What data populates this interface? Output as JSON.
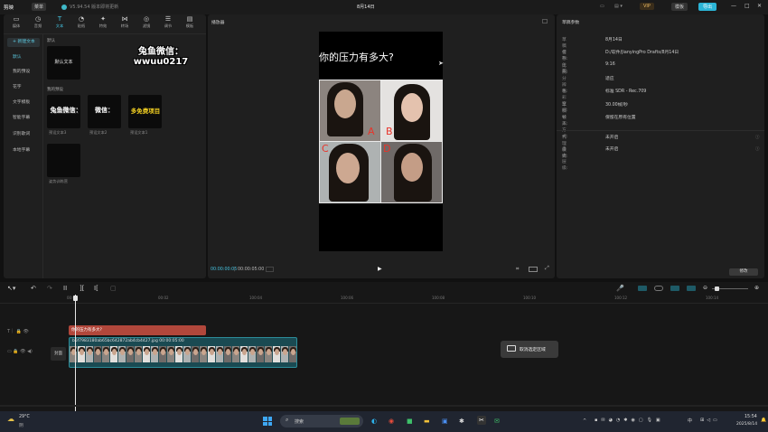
{
  "app": {
    "name": "剪映",
    "menu": "菜单",
    "version_label": "V5.94.54 版本即将更新",
    "project_title": "8月14日",
    "vip": "VIP",
    "share": "模板",
    "export": "导出"
  },
  "toolbar": [
    {
      "label": "媒体",
      "icon": "media-icon"
    },
    {
      "label": "音频",
      "icon": "audio-icon"
    },
    {
      "label": "文本",
      "icon": "text-icon"
    },
    {
      "label": "贴纸",
      "icon": "sticker-icon"
    },
    {
      "label": "特效",
      "icon": "effects-icon"
    },
    {
      "label": "转场",
      "icon": "transition-icon"
    },
    {
      "label": "滤镜",
      "icon": "filter-icon"
    },
    {
      "label": "调节",
      "icon": "adjust-icon"
    },
    {
      "label": "模板",
      "icon": "template-icon"
    }
  ],
  "sidebar": [
    "+ 新建文本",
    "默认",
    "我的预设",
    "花字",
    "文字模板",
    "智能字幕",
    "识别歌词",
    "本地字幕"
  ],
  "text_library": {
    "default_section": "默认",
    "default_card": "默认文本",
    "watermark": "兔鱼微信：\nwwuu0217",
    "presets_section": "我的预设",
    "presets": [
      {
        "preview": "兔鱼微信：",
        "caption": "预设文本3"
      },
      {
        "preview": "微信：",
        "caption": "预设文本2"
      },
      {
        "preview": "多免费项目",
        "caption": "预设文本1"
      },
      {
        "preview": "",
        "caption": "姿势训练营"
      }
    ]
  },
  "player": {
    "title": "播放器",
    "question": "你的压力有多大?",
    "letters": [
      "A",
      "B",
      "C",
      "D"
    ],
    "time_current": "00:00:00:05",
    "time_total": "00:00:05:00"
  },
  "props": {
    "title": "草稿参数",
    "rows": [
      {
        "label": "草稿名称:",
        "value": "8月14日"
      },
      {
        "label": "保存位置:",
        "value": "D:/软件/JianyingPro Drafts/8月14日"
      },
      {
        "label": "比例:",
        "value": "9:16"
      },
      {
        "label": "分辨率:",
        "value": "适应"
      },
      {
        "label": "色彩空间:",
        "value": "标准 SDR - Rec.709"
      },
      {
        "label": "草稿帧率:",
        "value": "30.00帧/秒"
      },
      {
        "label": "导入方式:",
        "value": "保留在原有位置"
      }
    ],
    "rows2": [
      {
        "label": "代理模式:",
        "value": "未开启"
      },
      {
        "label": "自由层级:",
        "value": "未开启"
      }
    ],
    "modify": "修改"
  },
  "timeline": {
    "ticks": [
      "00:00",
      "00:02",
      "100:04",
      "100:06",
      "100:08",
      "100:10",
      "100:12",
      "100:14"
    ],
    "text_clip": "你的压力有多大?",
    "video_clip": "b5f7983180ab65bc642872ab4cb4427.jpg  00:00:05:00",
    "cover": "封面",
    "toast": "取消选定区域"
  },
  "weather": {
    "temp": "29°C",
    "desc": "阴"
  },
  "taskbar": {
    "search": "搜索",
    "lang": "中",
    "time": "15:54",
    "date": "2025/8/14"
  }
}
